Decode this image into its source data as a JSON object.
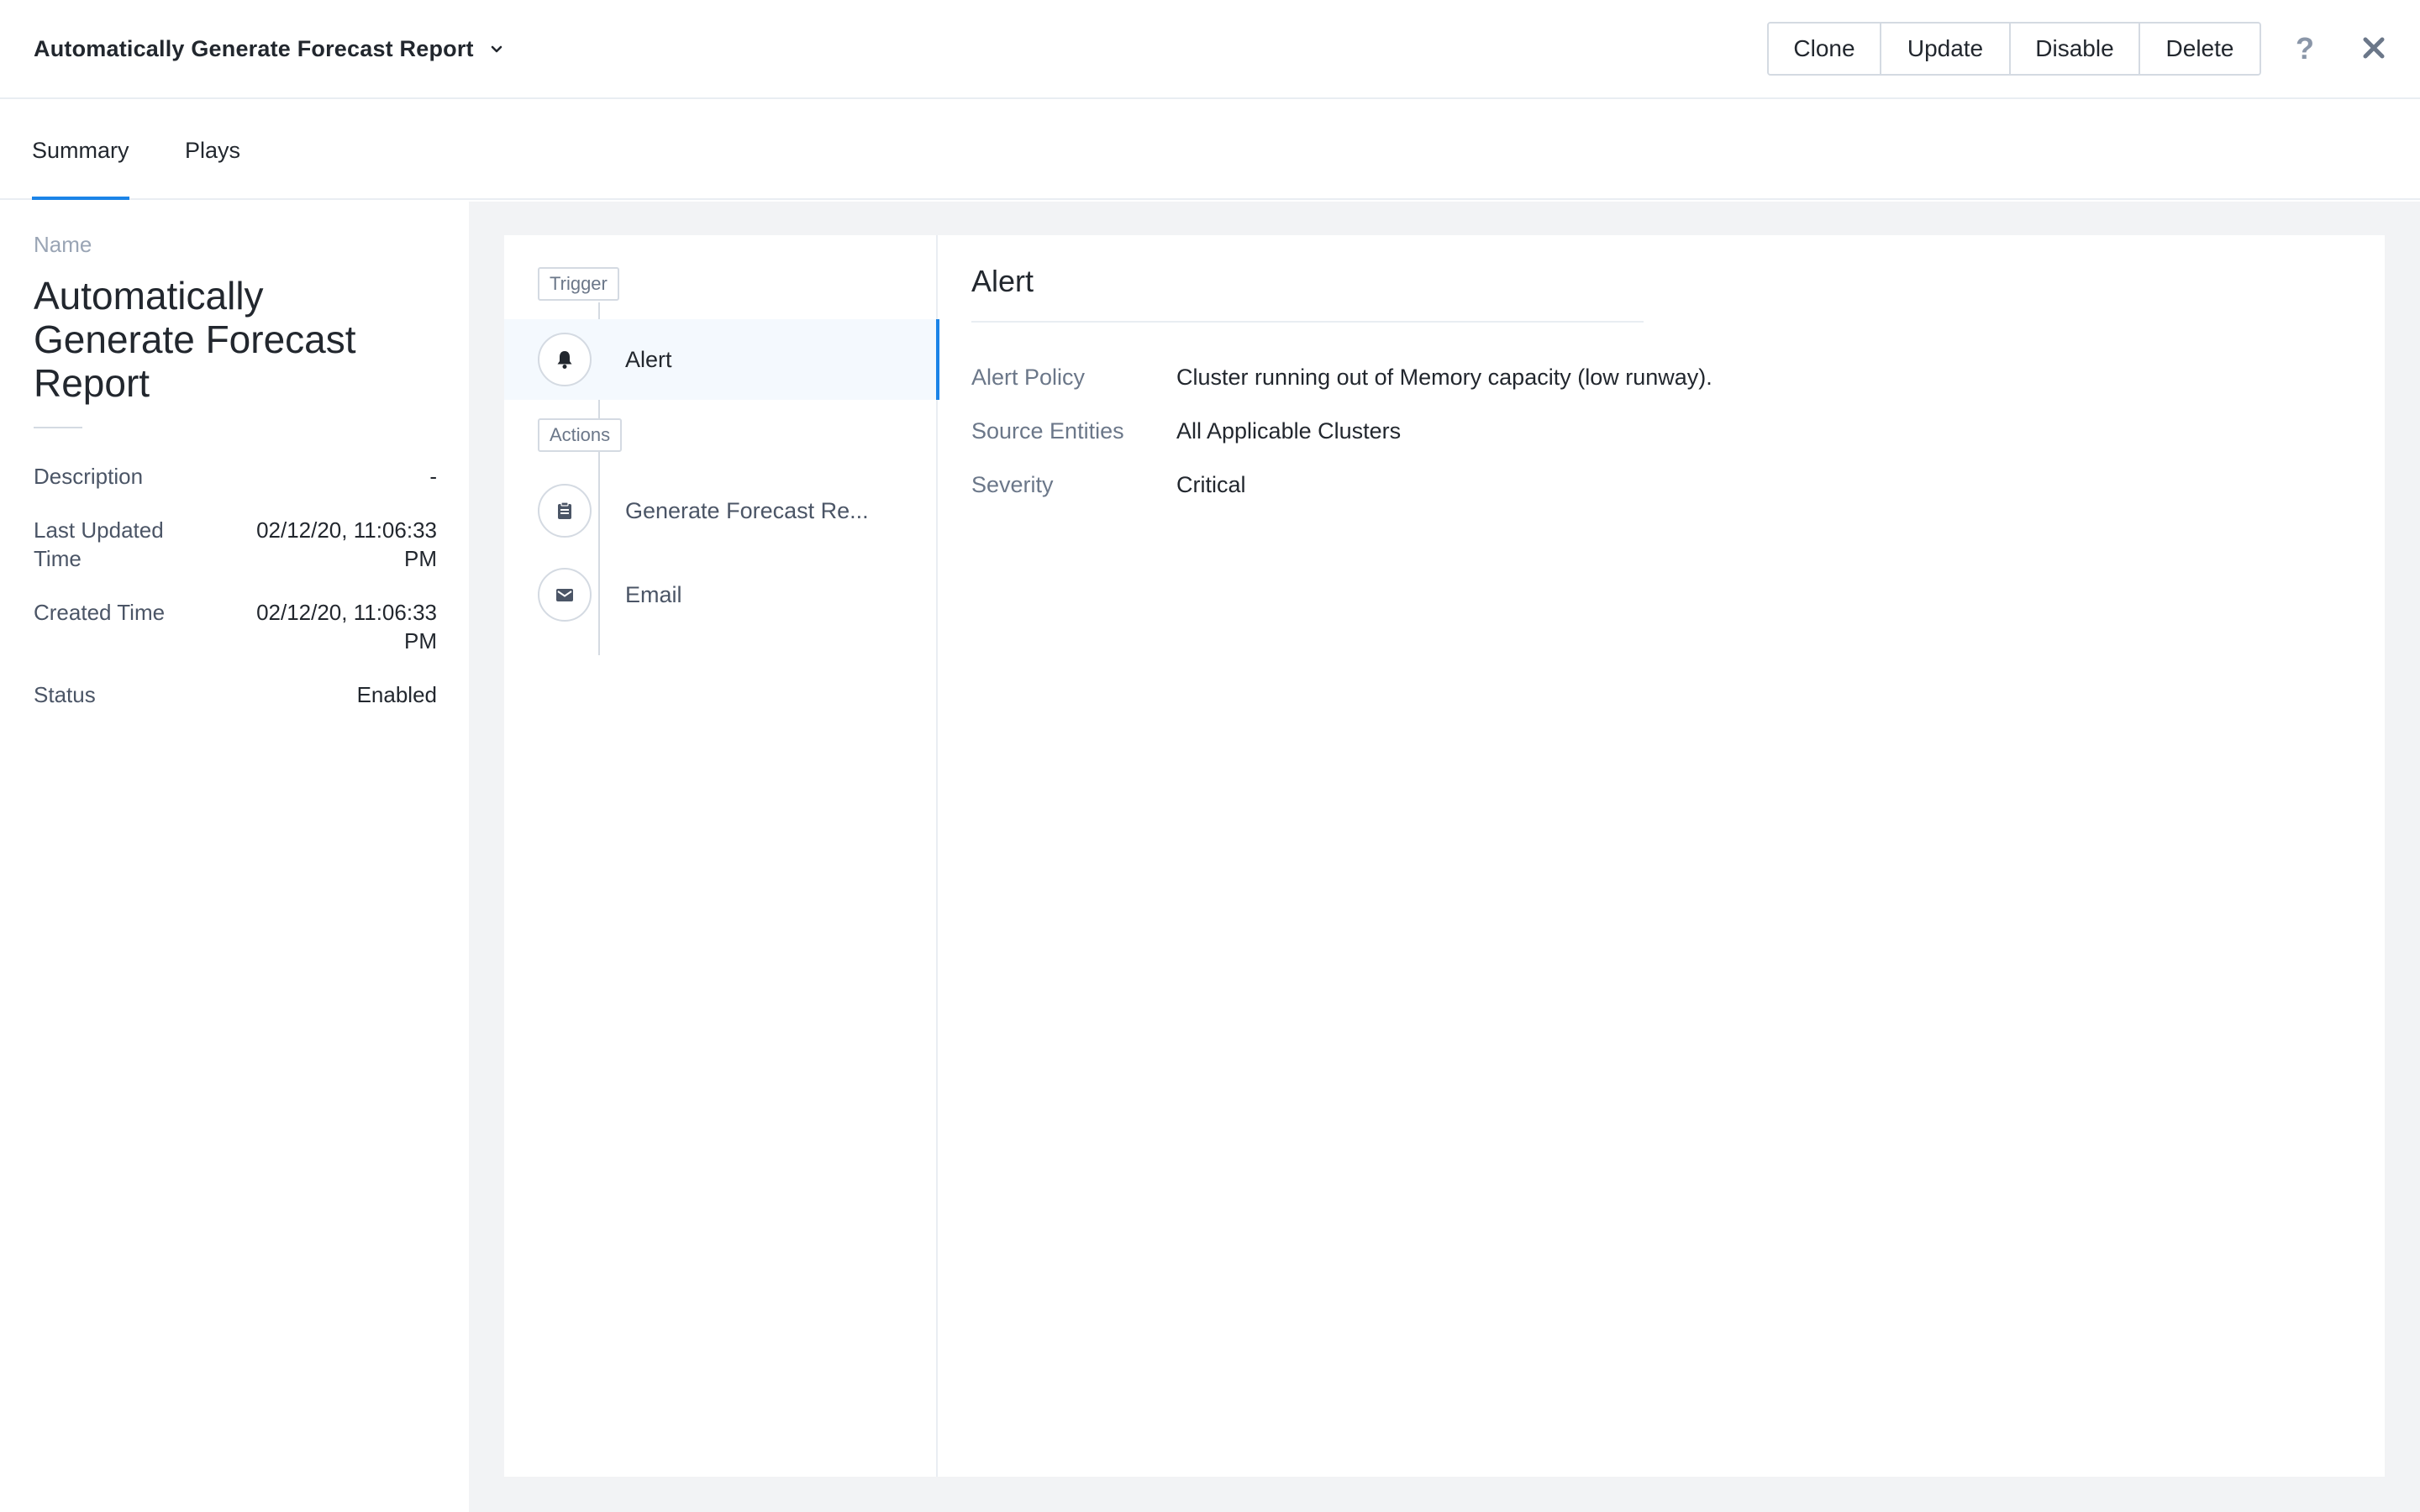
{
  "header": {
    "title": "Automatically Generate Forecast Report",
    "buttons": [
      "Clone",
      "Update",
      "Disable",
      "Delete"
    ],
    "help_label": "?",
    "icons": {
      "title_menu": "chevron-down-icon",
      "help": "help-icon",
      "close": "close-icon"
    }
  },
  "tabs": [
    {
      "label": "Summary",
      "active": true
    },
    {
      "label": "Plays",
      "active": false
    }
  ],
  "summary": {
    "name_label": "Name",
    "name_value": "Automatically Generate Forecast Report",
    "rows": [
      {
        "key": "Description",
        "value": "-"
      },
      {
        "key": "Last Updated Time",
        "value": "02/12/20, 11:06:33 PM"
      },
      {
        "key": "Created Time",
        "value": "02/12/20, 11:06:33 PM"
      },
      {
        "key": "Status",
        "value": "Enabled"
      }
    ]
  },
  "flow": {
    "trigger_tag": "Trigger",
    "actions_tag": "Actions",
    "items": [
      {
        "label": "Alert",
        "icon": "bell-icon",
        "selected": true
      },
      {
        "label": "Generate Forecast Re...",
        "icon": "clipboard-icon",
        "selected": false
      },
      {
        "label": "Email",
        "icon": "mail-icon",
        "selected": false
      }
    ]
  },
  "detail": {
    "title": "Alert",
    "rows": [
      {
        "key": "Alert Policy",
        "value": "Cluster running out of Memory capacity (low runway)."
      },
      {
        "key": "Source Entities",
        "value": "All Applicable Clusters"
      },
      {
        "key": "Severity",
        "value": "Critical"
      }
    ]
  },
  "colors": {
    "accent": "#1b84e7",
    "text_primary": "#22272e",
    "text_muted": "#6b7789",
    "background_gray": "#f2f3f5",
    "border": "#d4dae2"
  }
}
